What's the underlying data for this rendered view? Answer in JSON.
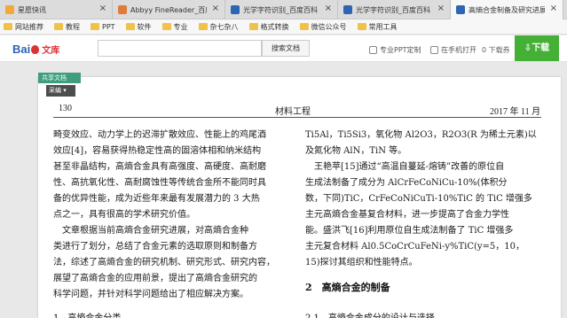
{
  "tabs": [
    {
      "label": "星愿快讯",
      "active": false,
      "color": "#f2a93b"
    },
    {
      "label": "Abbyy FineReader_百度...",
      "active": false,
      "color": "#e07b39"
    },
    {
      "label": "光学字符识别_百度百科",
      "active": false,
      "color": "#2d64b3"
    },
    {
      "label": "光学字符识别_百度百科",
      "active": false,
      "color": "#2d64b3"
    },
    {
      "label": "高熵合金制备及研究进展",
      "active": true,
      "color": "#2d64b3"
    }
  ],
  "bookmarks": [
    "网站推荐",
    "教程",
    "PPT",
    "软件",
    "专业",
    "杂七杂八",
    "格式转换",
    "微信公众号",
    "常用工具"
  ],
  "header": {
    "logo_text": "Bai",
    "logo_suffix": "文库",
    "search_button": "搜索文档",
    "ppt": "专业PPT定制",
    "open": "在手机打开",
    "dl_count": "0 下载券",
    "download": "下载"
  },
  "badges": {
    "share": "共享文档",
    "cai": "采编"
  },
  "doc": {
    "page_number": "130",
    "journal": "材料工程",
    "date": "2017 年 11 月",
    "left_lines": [
      "畸变效应、动力学上的迟滞扩散效应、性能上的鸡尾酒",
      "效应[4]，容易获得热稳定性高的固溶体相和纳米结构",
      "甚至非晶结构，高熵合金具有高强度、高硬度、高耐磨",
      "性、高抗氧化性、高耐腐蚀性等传统合金所不能同时具",
      "备的优异性能，成为近些年来最有发展潜力的 3 大热",
      "点之一，具有很高的学术研究价值。",
      "　文章根据当前高熵合金研究进展，对高熵合金种",
      "类进行了划分，总结了合金元素的选取原则和制备方",
      "法，综述了高熵合金的研究机制、研究形式、研究内容，",
      "展望了高熵合金的应用前景，提出了高熵合金研究的",
      "科学问题，并针对科学问题给出了相应解决方案。"
    ],
    "right_lines": [
      "Ti5Al，Ti5Si3，氧化物 Al2O3，R2O3(R 为稀土元素)以",
      "及氮化物 AlN，TiN 等。",
      "　王艳苹[15]通过“高温自蔓延-熔铸”改善的原位自",
      "生成法制备了成分为 AlCrFeCoNiCu-10%(体积分",
      "数，下同)TiC，CrFeCoNiCuTi-10%TiC 的 TiC 增强多",
      "主元高熵合金基复合材料，进一步提高了合金力学性",
      "能。盛洪飞[16]利用原位自生成法制备了 TiC 增强多",
      "主元复合材料 Al0.5CoCrCuFeNi-y%TiC(y=5，10，",
      "15)探讨其组织和性能特点。"
    ],
    "section_heading": "2　高熵合金的制备",
    "bottom_left": "1　高熵合金分类",
    "bottom_right": "2.1　高熵合金成分的设计与选择"
  }
}
